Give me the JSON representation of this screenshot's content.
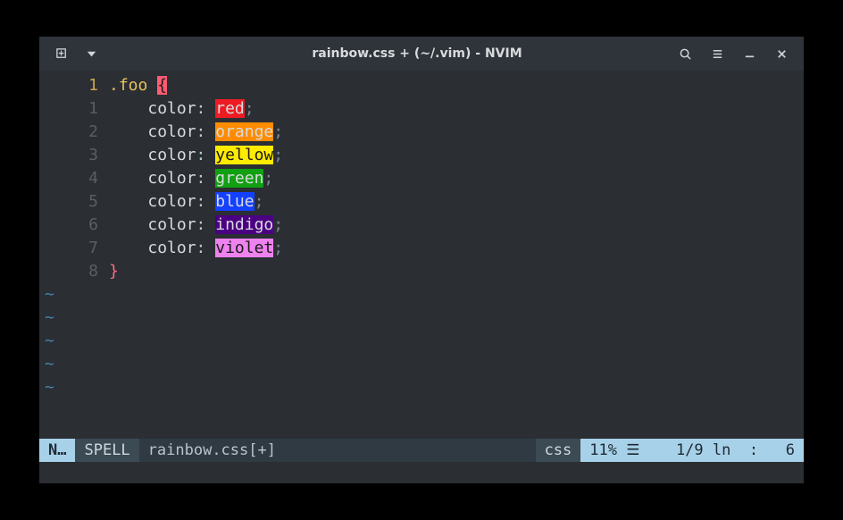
{
  "titlebar": {
    "title": "rainbow.css + (~/.vim) - NVIM"
  },
  "editor": {
    "gutter": [
      "1",
      "1",
      "2",
      "3",
      "4",
      "5",
      "6",
      "7",
      "8"
    ],
    "selector": ".foo",
    "open_brace": "{",
    "close_brace": "}",
    "property": "color",
    "colon": ":",
    "semi": ";",
    "colors": [
      {
        "name": "red",
        "cls": "bg-red"
      },
      {
        "name": "orange",
        "cls": "bg-orange"
      },
      {
        "name": "yellow",
        "cls": "bg-yellow"
      },
      {
        "name": "green",
        "cls": "bg-green"
      },
      {
        "name": "blue",
        "cls": "bg-blue"
      },
      {
        "name": "indigo",
        "cls": "bg-indigo"
      },
      {
        "name": "violet",
        "cls": "bg-violet"
      }
    ],
    "tilde": "~",
    "tilde_count": 5
  },
  "statusbar": {
    "mode": "N…",
    "spell": "SPELL",
    "filename": "rainbow.css[+]",
    "filetype": "css",
    "percent": "11% ☰",
    "position": "  1/9 ln  :   6"
  }
}
